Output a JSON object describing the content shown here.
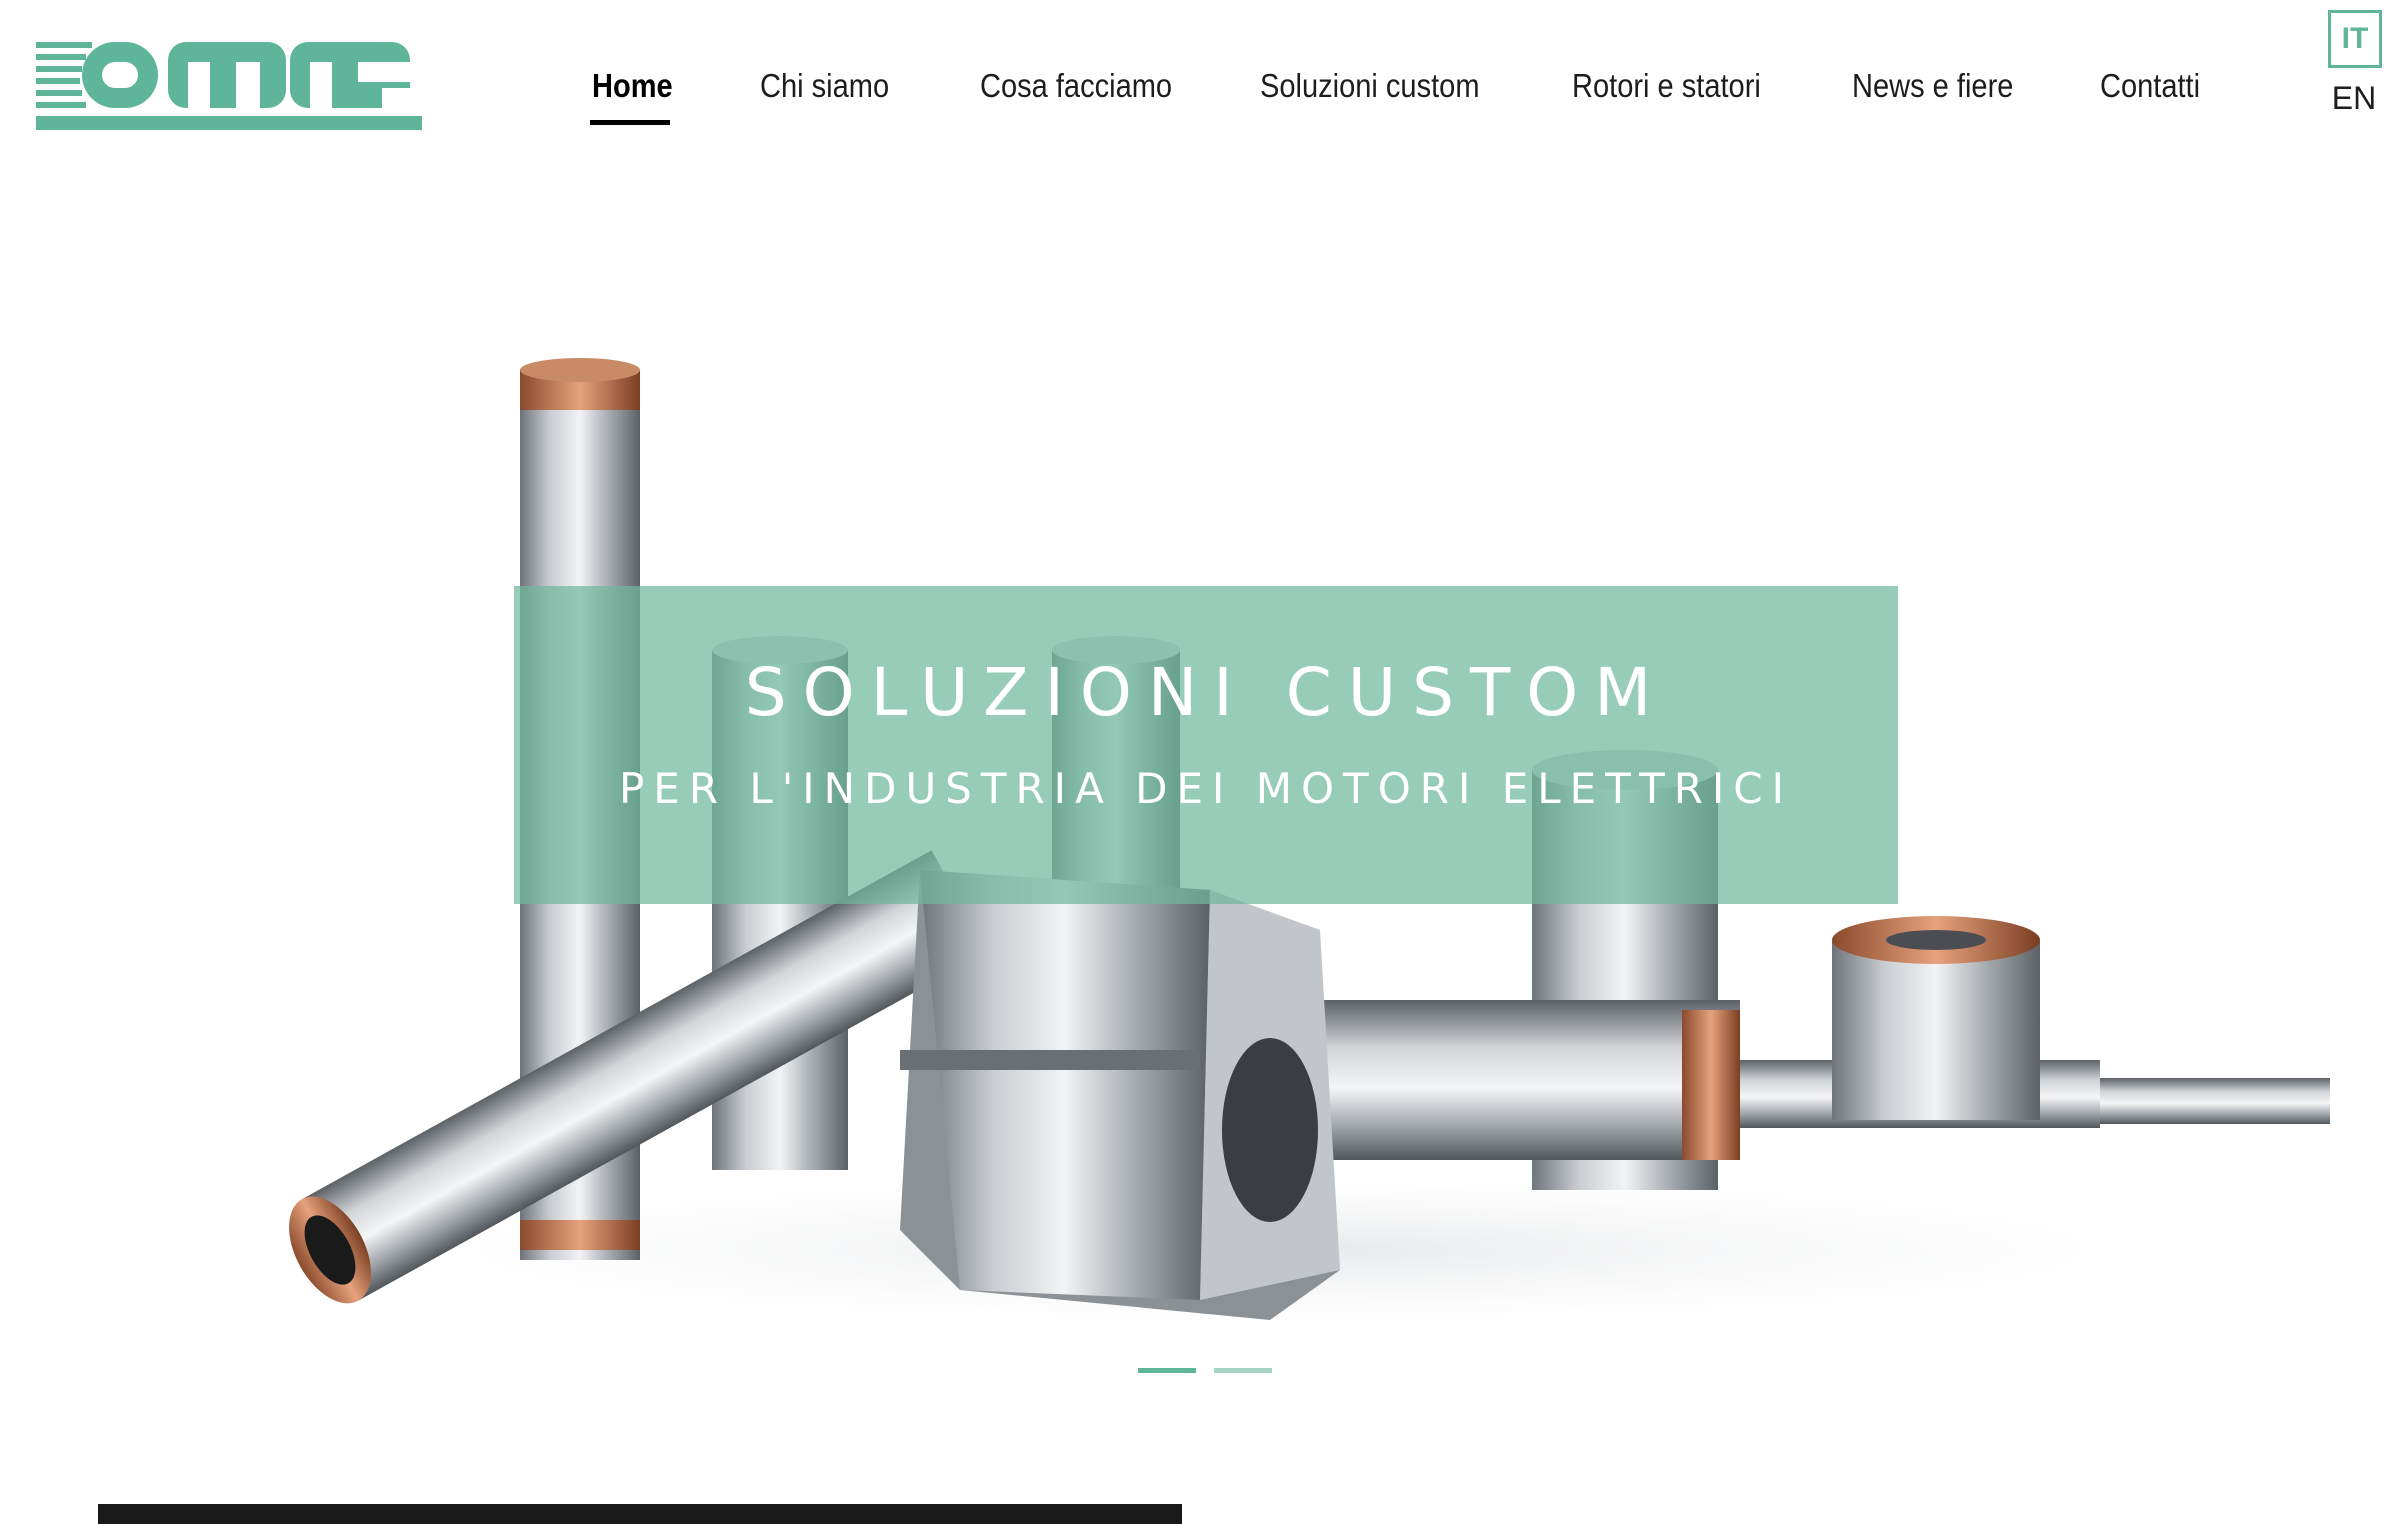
{
  "brand": {
    "logo_alt": "OMM2",
    "accent_color": "#5fb59a",
    "banner_color": "#6eb89c"
  },
  "nav": {
    "items": [
      {
        "label": "Home",
        "active": true
      },
      {
        "label": "Chi siamo"
      },
      {
        "label": "Cosa facciamo"
      },
      {
        "label": "Soluzioni custom"
      },
      {
        "label": "Rotori e statori"
      },
      {
        "label": "News e fiere"
      },
      {
        "label": "Contatti"
      }
    ]
  },
  "language": {
    "current": "IT",
    "alternate": "EN"
  },
  "hero": {
    "title": "SOLUZIONI CUSTOM",
    "subtitle": "PER L'INDUSTRIA DEI MOTORI ELETTRICI",
    "slide_count": 2,
    "active_slide": 1
  },
  "icons": [
    "logo-icon"
  ]
}
